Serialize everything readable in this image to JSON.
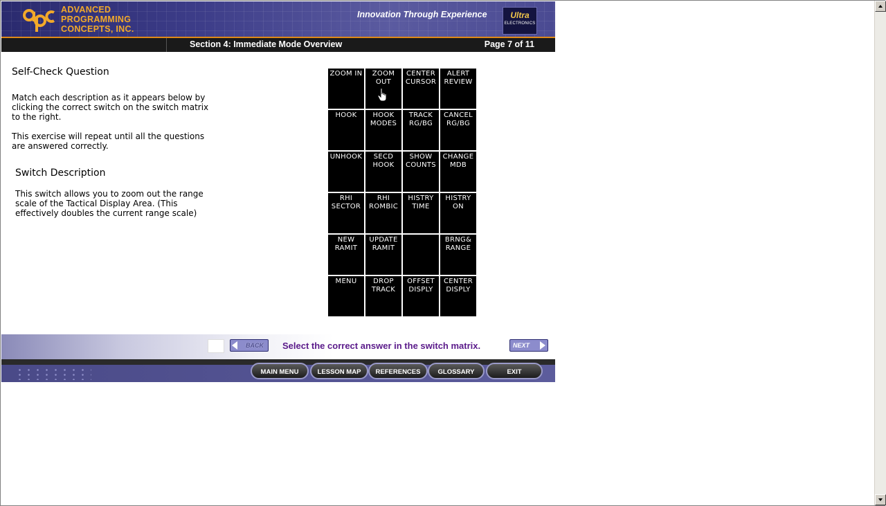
{
  "header": {
    "company_lines": [
      "ADVANCED",
      "PROGRAMMING",
      "CONCEPTS, INC."
    ],
    "tagline": "Innovation Through Experience",
    "partner_logo": {
      "line1": "Ultra",
      "line2": "ELECTRONICS"
    }
  },
  "section_bar": {
    "title": "Section 4: Immediate Mode Overview",
    "page": "Page 7 of 11"
  },
  "content": {
    "question_heading": "Self-Check Question",
    "instructions": "Match each description as it appears below by clicking the correct switch on the switch matrix to the right.",
    "repeat_note": "This exercise will repeat until all the questions are answered correctly.",
    "description_heading": "Switch Description",
    "description_text": "This switch allows you to zoom out the range scale of the Tactical Display Area. (This effectively doubles the current range scale)"
  },
  "switch_matrix": [
    [
      "ZOOM IN",
      "ZOOM\nOUT",
      "CENTER\nCURSOR",
      "ALERT\nREVIEW"
    ],
    [
      "HOOK",
      "HOOK\nMODES",
      "TRACK\nRG/BG",
      "CANCEL\nRG/BG"
    ],
    [
      "UNHOOK",
      "SECD\nHOOK",
      "SHOW\nCOUNTS",
      "CHANGE\nMDB"
    ],
    [
      "RHI\nSECTOR",
      "RHI\nROMBIC",
      "HISTRY\nTIME",
      "HISTRY\nON"
    ],
    [
      "NEW\nRAMIT",
      "UPDATE\nRAMIT",
      "",
      "BRNG&\nRANGE"
    ],
    [
      "MENU",
      "DROP\nTRACK",
      "OFFSET\nDISPLY",
      "CENTER\nDISPLY"
    ]
  ],
  "navigation": {
    "back_label": "BACK",
    "next_label": "NEXT",
    "instruction": "Select the correct answer in the switch matrix."
  },
  "footer_buttons": [
    "MAIN MENU",
    "LESSON MAP",
    "REFERENCES",
    "GLOSSARY",
    "EXIT"
  ],
  "colors": {
    "header_bg": "#3c3c88",
    "brand_orange": "#f2a92a",
    "instruction_purple": "#5a1a8a",
    "switch_bg": "#000000"
  },
  "icons": {
    "cursor": "hand-pointer-icon",
    "back": "arrow-left-icon",
    "next": "arrow-right-icon"
  }
}
